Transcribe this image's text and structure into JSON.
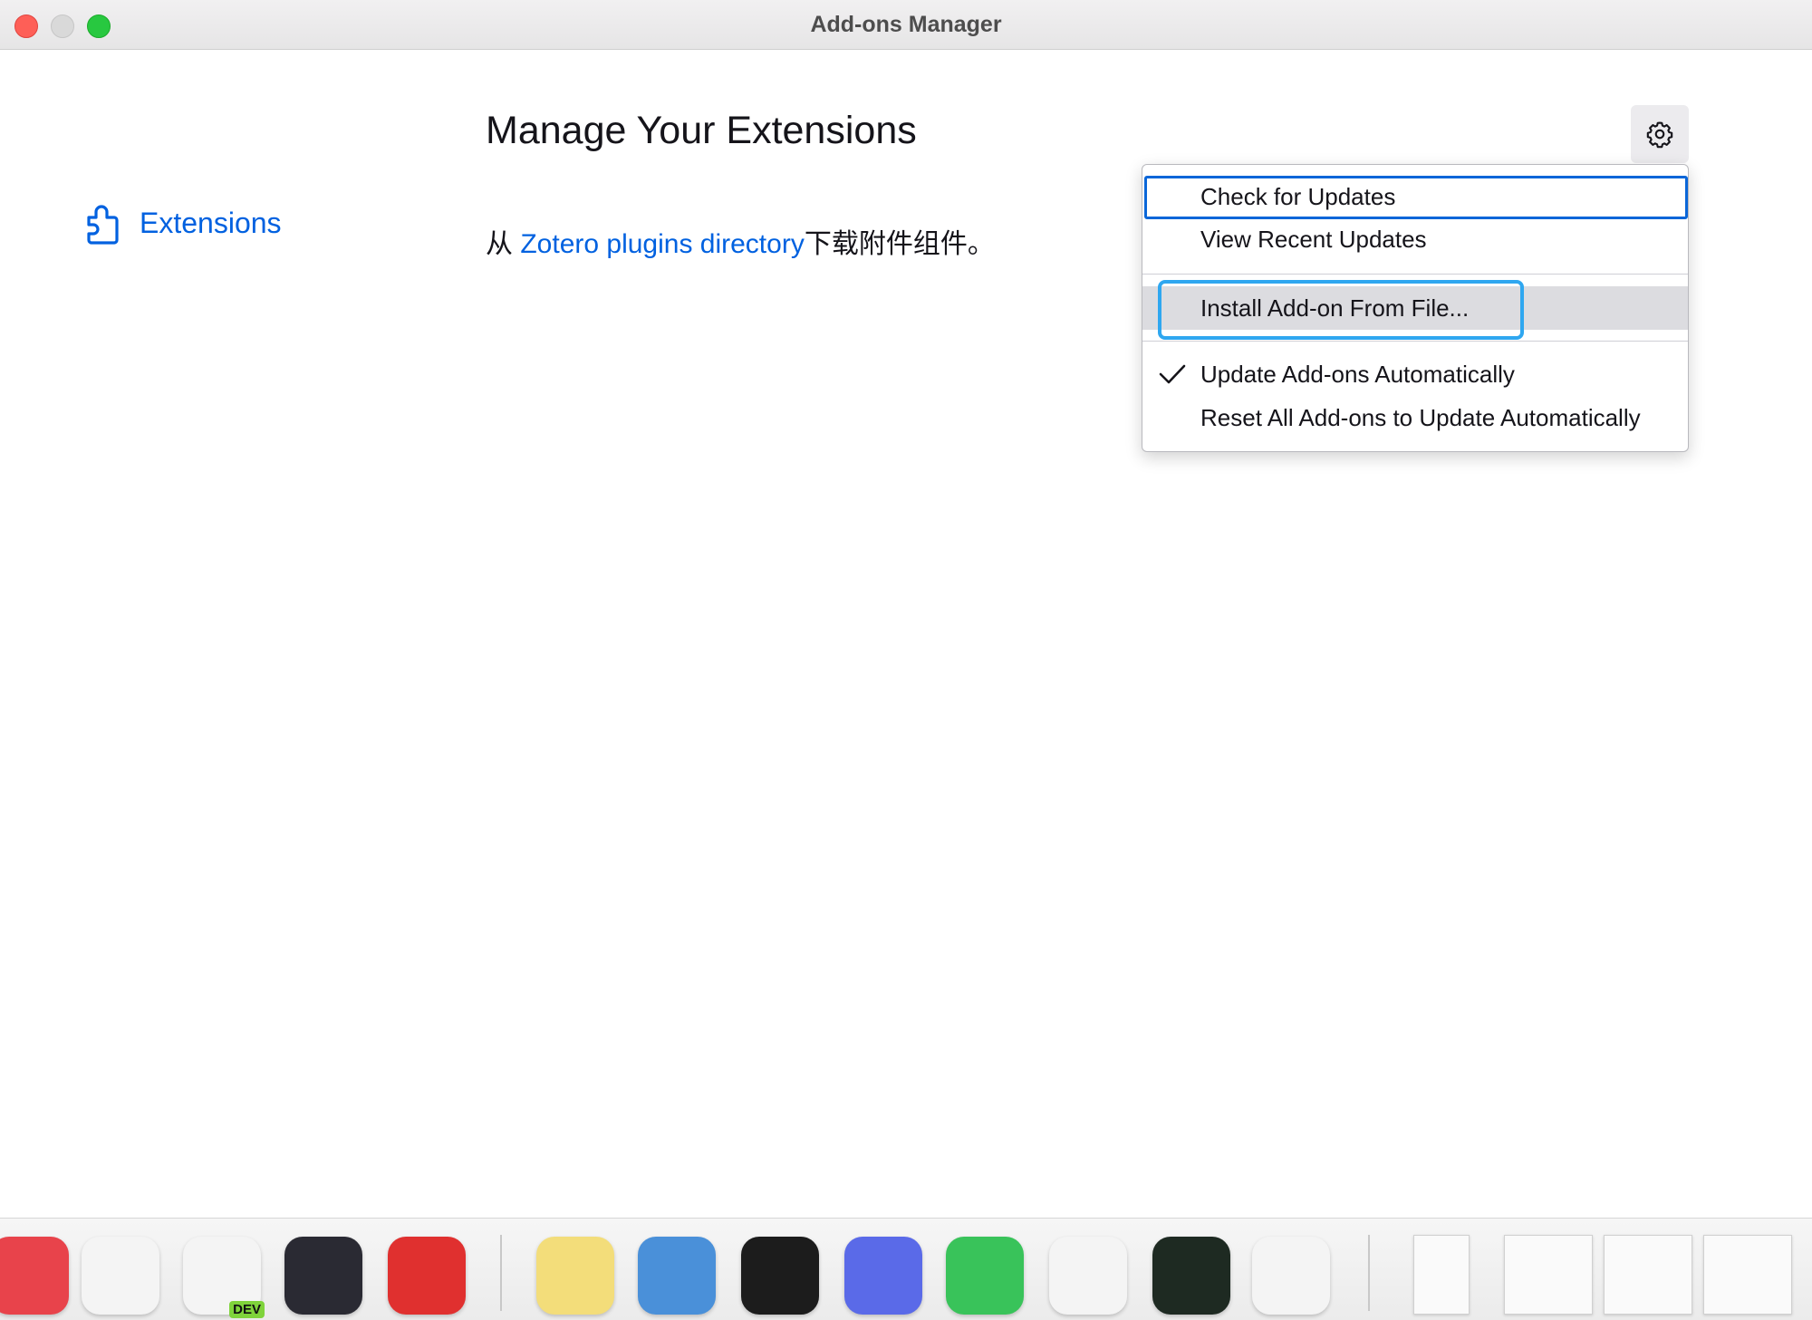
{
  "window": {
    "title": "Add-ons Manager"
  },
  "sidebar": {
    "extensions_label": "Extensions"
  },
  "main": {
    "heading": "Manage Your Extensions",
    "intro_prefix": "从 ",
    "intro_link": "Zotero plugins directory",
    "intro_suffix": "下载附件组件。"
  },
  "menu": {
    "check_updates": "Check for Updates",
    "view_recent": "View Recent Updates",
    "install_file": "Install Add-on From File...",
    "update_auto": "Update Add-ons Automatically",
    "update_auto_checked": true,
    "reset_auto": "Reset All Add-ons to Update Automatically"
  },
  "dock": {
    "apps": [
      {
        "name": "app-a-icon",
        "color": "#e8434b"
      },
      {
        "name": "chrome-icon",
        "color": "#f4f4f4"
      },
      {
        "name": "edge-dev-icon",
        "color": "#f4f4f4",
        "badge": "DEV"
      },
      {
        "name": "obsidian-icon",
        "color": "#2a2a33"
      },
      {
        "name": "netease-music-icon",
        "color": "#e0302f"
      },
      {
        "name": "stickies-icon",
        "color": "#f3dd7a"
      },
      {
        "name": "app-blue-icon",
        "color": "#4a90d9"
      },
      {
        "name": "terminal-icon",
        "color": "#1c1c1c"
      },
      {
        "name": "app-ring-icon",
        "color": "#5a6ae8"
      },
      {
        "name": "wechat-icon",
        "color": "#39c35a"
      },
      {
        "name": "word-icon",
        "color": "#f4f4f4"
      },
      {
        "name": "activity-monitor-icon",
        "color": "#1e2a22"
      },
      {
        "name": "zotero-icon",
        "color": "#f4f4f4"
      }
    ],
    "accent": "#0061e0"
  }
}
